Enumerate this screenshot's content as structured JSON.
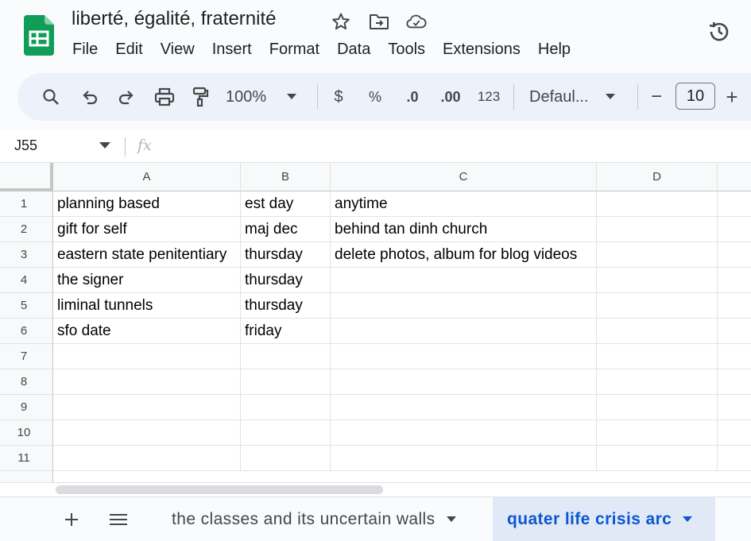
{
  "document": {
    "title": "liberté, égalité, fraternité",
    "icons": [
      "star-icon",
      "move-to-folder-icon",
      "cloud-saved-icon",
      "version-history-icon"
    ]
  },
  "menu": {
    "items": [
      "File",
      "Edit",
      "View",
      "Insert",
      "Format",
      "Data",
      "Tools",
      "Extensions",
      "Help"
    ]
  },
  "toolbar": {
    "zoom": "100%",
    "currency": "$",
    "percent": "%",
    "decrease_decimal": ".0",
    "increase_decimal": ".00",
    "number_format": "123",
    "font": "Defaul...",
    "minus": "−",
    "font_size": "10",
    "plus": "+"
  },
  "formula_bar": {
    "name_box": "J55",
    "fx": "fx",
    "formula": ""
  },
  "grid": {
    "columns": [
      "A",
      "B",
      "C",
      "D"
    ],
    "row_numbers": [
      "1",
      "2",
      "3",
      "4",
      "5",
      "6",
      "7",
      "8",
      "9",
      "10",
      "11"
    ],
    "rows": [
      [
        "planning based",
        "est day",
        "anytime",
        ""
      ],
      [
        "gift for self",
        "maj dec",
        "behind tan dinh church",
        ""
      ],
      [
        "eastern state penitentiary",
        "thursday",
        "delete photos, album for blog videos",
        ""
      ],
      [
        "the signer",
        "thursday",
        "",
        ""
      ],
      [
        "liminal tunnels",
        "thursday",
        "",
        ""
      ],
      [
        "sfo date",
        "friday",
        "",
        ""
      ],
      [
        "",
        "",
        "",
        ""
      ],
      [
        "",
        "",
        "",
        ""
      ],
      [
        "",
        "",
        "",
        ""
      ],
      [
        "",
        "",
        "",
        ""
      ],
      [
        "",
        "",
        "",
        ""
      ]
    ]
  },
  "sheets": {
    "tabs": [
      {
        "label": "the classes and its uncertain walls",
        "active": false
      },
      {
        "label": "quater life crisis arc",
        "active": true
      }
    ]
  },
  "colors": {
    "brand_green": "#0f9d58",
    "active_tab_text": "#0b57d0",
    "active_tab_bg": "#e1e9f7",
    "toolbar_bg": "#edf2fa"
  }
}
